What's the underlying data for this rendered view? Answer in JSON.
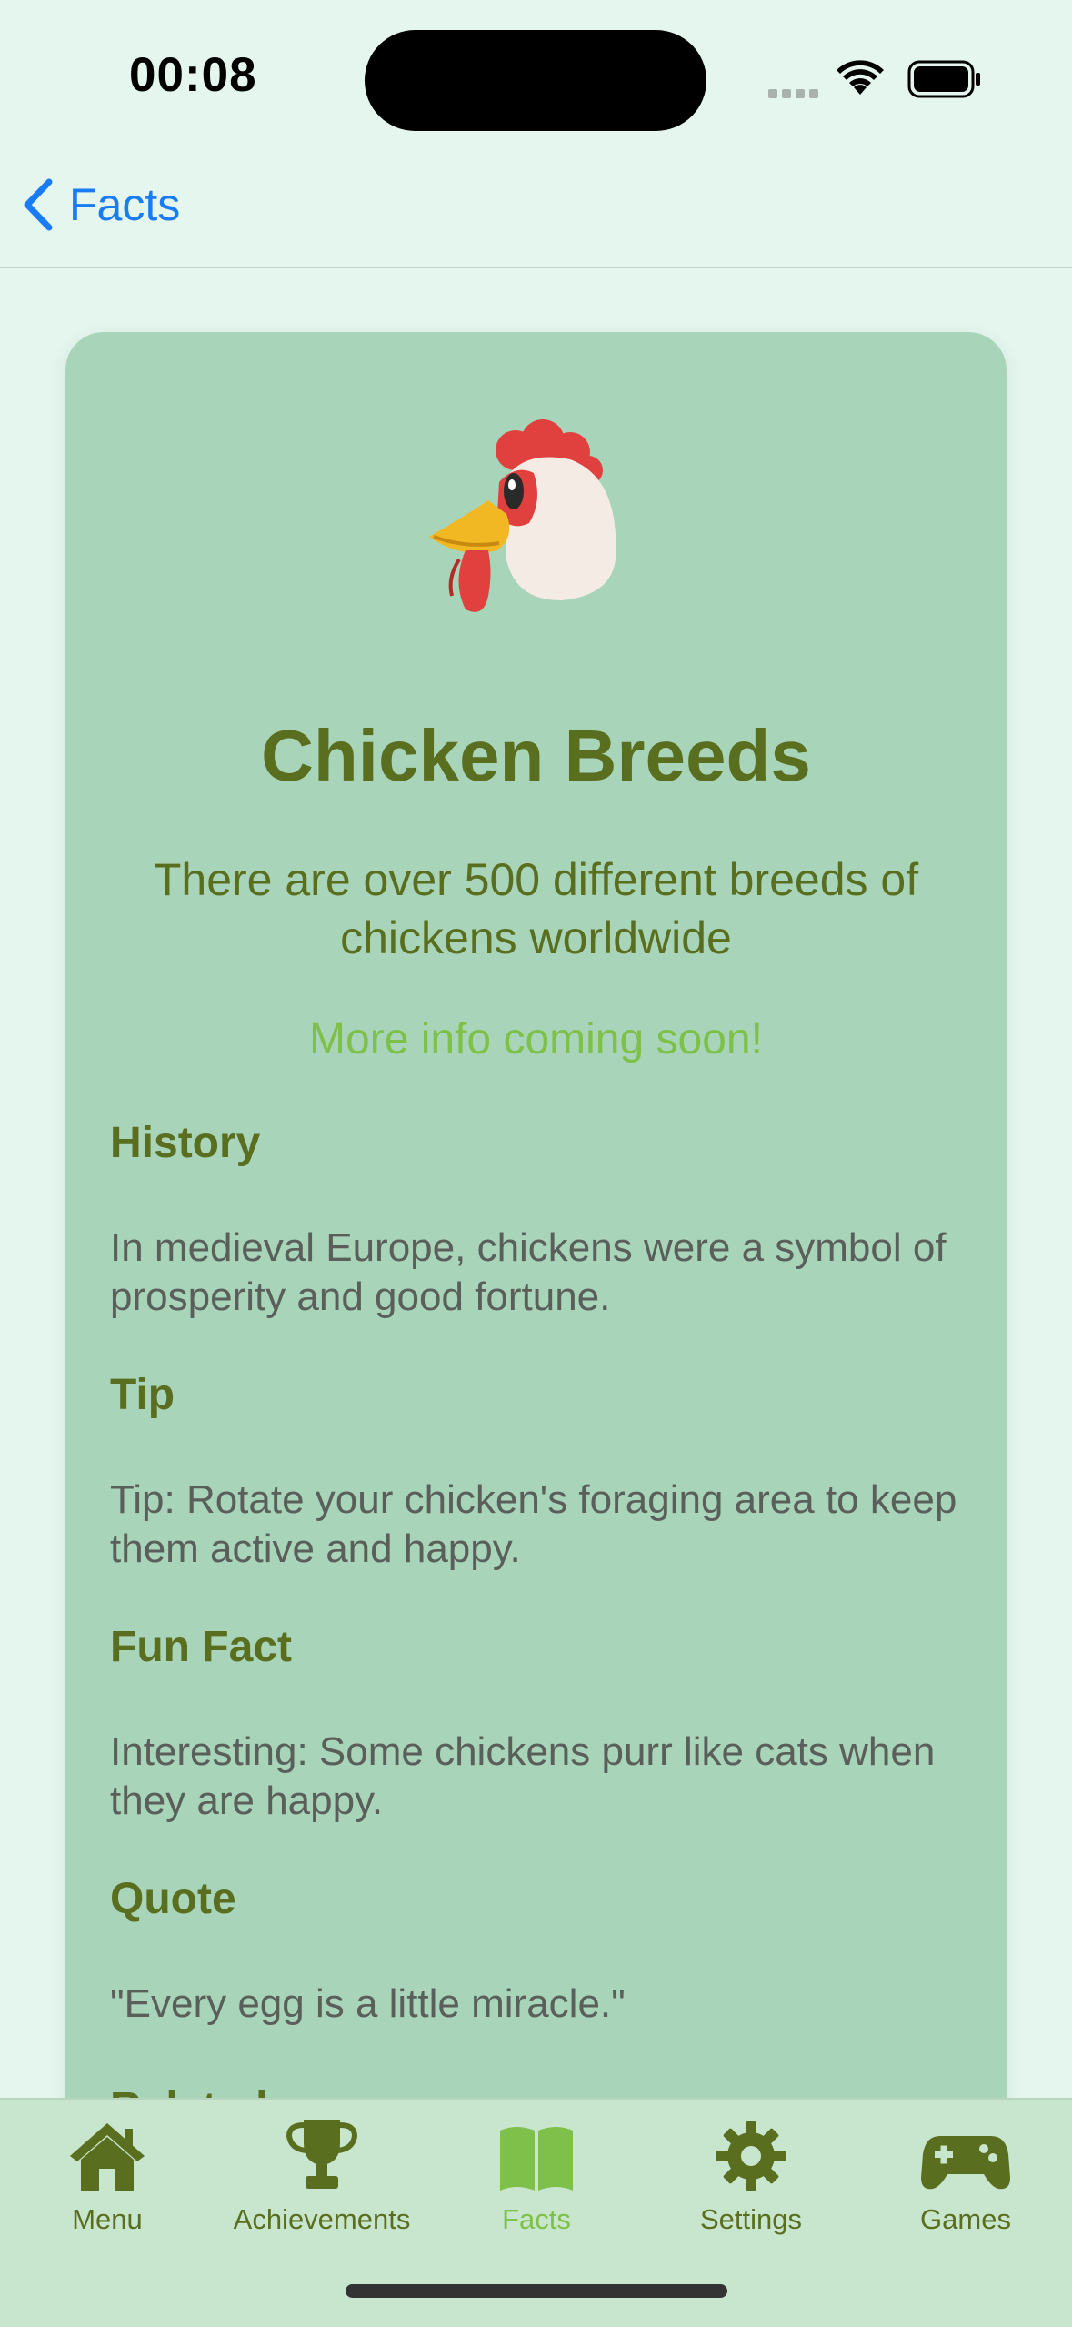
{
  "status_bar": {
    "time": "00:08"
  },
  "nav": {
    "back_label": "Facts"
  },
  "card": {
    "emoji": "🐔",
    "title": "Chicken Breeds",
    "subtitle": "There are over 500 different breeds of chickens worldwide",
    "more_info": "More info coming soon!",
    "sections": [
      {
        "heading": "History",
        "body": "In medieval Europe, chickens were a symbol of prosperity and good fortune."
      },
      {
        "heading": "Tip",
        "body": "Tip: Rotate your chicken's foraging area to keep them active and happy."
      },
      {
        "heading": "Fun Fact",
        "body": "Interesting: Some chickens purr like cats when they are happy."
      },
      {
        "heading": "Quote",
        "body": "\"Every egg is a little miracle.\""
      },
      {
        "heading": "Related"
      }
    ]
  },
  "tabbar": {
    "tabs": [
      {
        "label": "Menu",
        "icon": "house-icon"
      },
      {
        "label": "Achievements",
        "icon": "trophy-icon"
      },
      {
        "label": "Facts",
        "icon": "book-icon",
        "active": true
      },
      {
        "label": "Settings",
        "icon": "gear-icon"
      },
      {
        "label": "Games",
        "icon": "gamecontroller-icon"
      }
    ]
  },
  "colors": {
    "background": "#e5f6ee",
    "card": "#a8d5b9",
    "heading_green": "#5a6e1f",
    "accent_green": "#7fc04a",
    "link_blue": "#1a7cf5",
    "tabbar": "#c8e6cd"
  }
}
